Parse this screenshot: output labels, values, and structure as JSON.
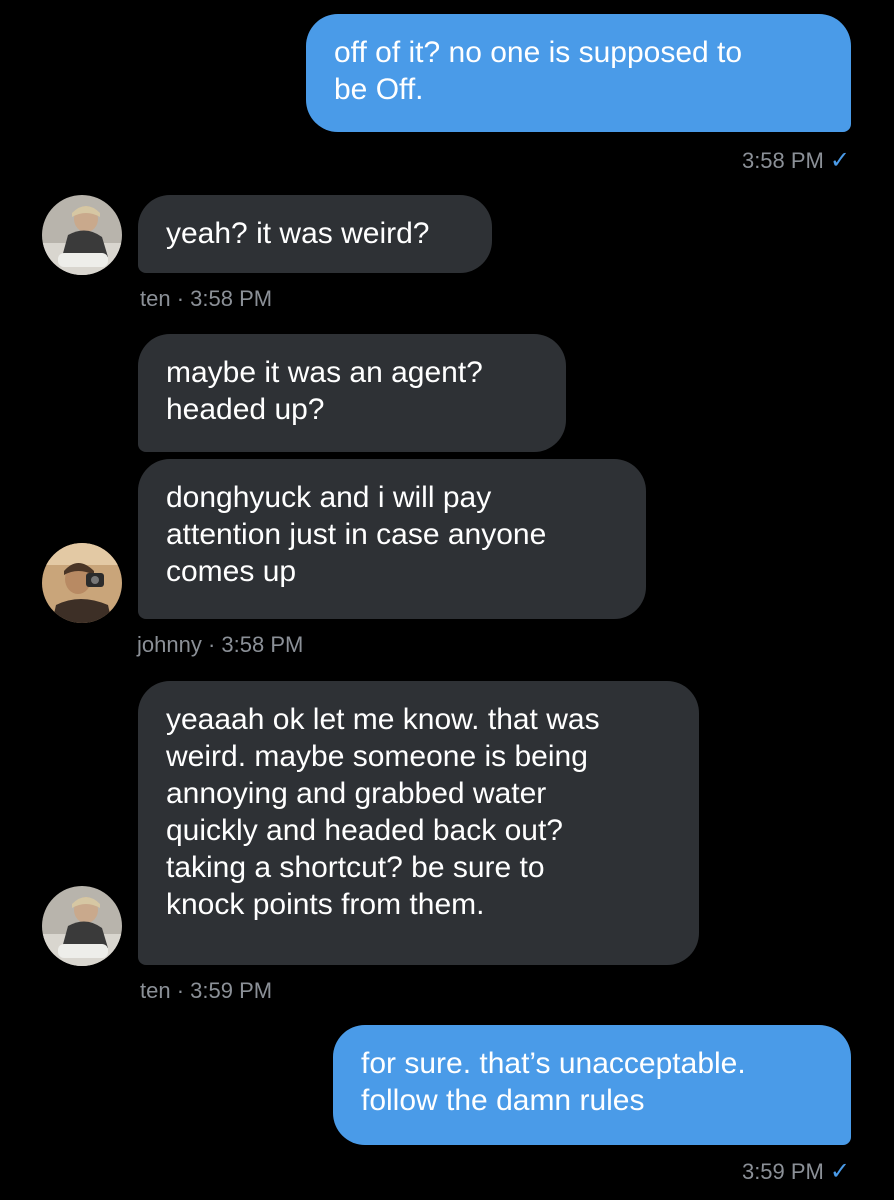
{
  "colors": {
    "background": "#000000",
    "outgoing_bubble": "#4a9be8",
    "incoming_bubble": "#2e3135",
    "meta_text": "#8b9097",
    "read_check": "#4a9be8"
  },
  "messages": [
    {
      "direction": "outgoing",
      "lines": [
        "off of it? no one is supposed to",
        "be Off."
      ],
      "time": "3:58 PM",
      "read_icon": "checkmark-icon"
    },
    {
      "direction": "incoming",
      "lines": [
        "yeah? it was weird?"
      ],
      "sender": "ten",
      "sep": "·",
      "time": "3:58 PM"
    },
    {
      "direction": "incoming",
      "lines": [
        "maybe it was an agent?",
        "headed up?"
      ]
    },
    {
      "direction": "incoming",
      "lines": [
        "donghyuck and i will pay",
        "attention just in case anyone",
        "comes up"
      ],
      "sender": "johnny",
      "sep": "·",
      "time": "3:58 PM"
    },
    {
      "direction": "incoming",
      "lines": [
        "yeaaah ok let me know. that was",
        "weird. maybe someone is being",
        "annoying and grabbed water",
        "quickly and headed back out?",
        "taking a shortcut? be sure to",
        "knock points from them."
      ],
      "sender": "ten",
      "sep": "·",
      "time": "3:59 PM"
    },
    {
      "direction": "outgoing",
      "lines": [
        "for sure. that’s unacceptable.",
        "follow the damn rules"
      ],
      "time": "3:59 PM",
      "read_icon": "checkmark-icon"
    }
  ],
  "check_glyph": "✓"
}
